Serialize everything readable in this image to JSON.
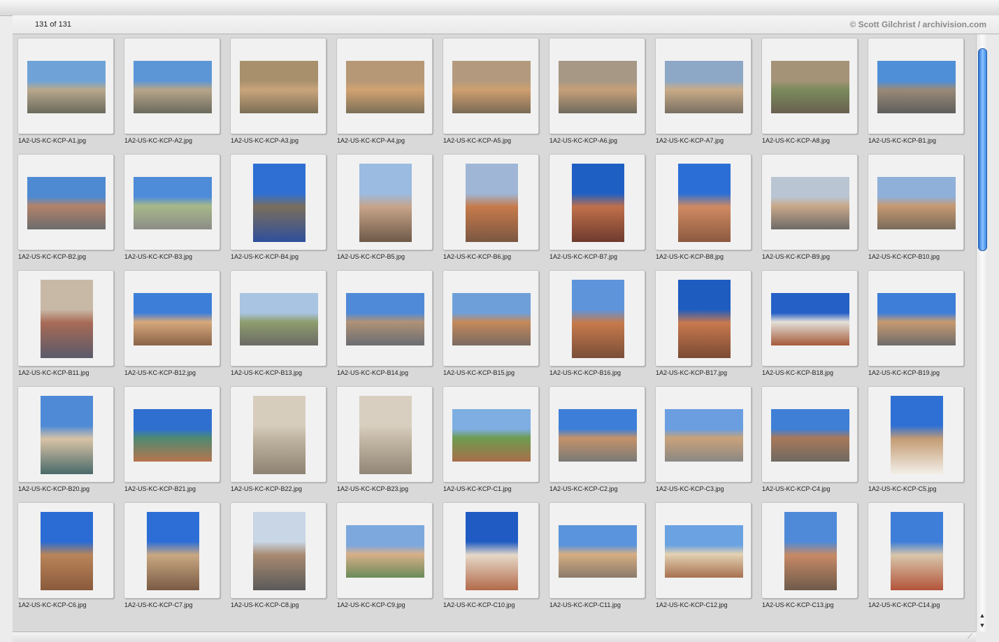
{
  "header": {
    "count": "131 of 131",
    "copyright": "© Scott Gilchrist / archivision.com"
  },
  "thumbnails": [
    {
      "name": "1A2-US-KC-KCP-A1.jpg",
      "orient": "landscape",
      "colors": [
        "#6fa3d8",
        "#b9a88d",
        "#6a6a5c"
      ]
    },
    {
      "name": "1A2-US-KC-KCP-A2.jpg",
      "orient": "landscape",
      "colors": [
        "#5c96d6",
        "#b8a58a",
        "#6b6a5e"
      ]
    },
    {
      "name": "1A2-US-KC-KCP-A3.jpg",
      "orient": "landscape",
      "colors": [
        "#a8906c",
        "#c9a47c",
        "#7b6f55"
      ]
    },
    {
      "name": "1A2-US-KC-KCP-A4.jpg",
      "orient": "landscape",
      "colors": [
        "#b69876",
        "#d2a272",
        "#7c7058"
      ]
    },
    {
      "name": "1A2-US-KC-KCP-A5.jpg",
      "orient": "landscape",
      "colors": [
        "#b39a7e",
        "#cf9f70",
        "#7a6b55"
      ]
    },
    {
      "name": "1A2-US-KC-KCP-A6.jpg",
      "orient": "landscape",
      "colors": [
        "#a69885",
        "#c7a07a",
        "#6f6a5d"
      ]
    },
    {
      "name": "1A2-US-KC-KCP-A7.jpg",
      "orient": "landscape",
      "colors": [
        "#8da8c6",
        "#c9ab86",
        "#797064"
      ]
    },
    {
      "name": "1A2-US-KC-KCP-A8.jpg",
      "orient": "landscape",
      "colors": [
        "#a59378",
        "#7a8a5c",
        "#6a6050"
      ]
    },
    {
      "name": "1A2-US-KC-KCP-B1.jpg",
      "orient": "landscape",
      "colors": [
        "#4f8fd8",
        "#9a8a78",
        "#5e5e5c"
      ]
    },
    {
      "name": "1A2-US-KC-KCP-B2.jpg",
      "orient": "landscape",
      "colors": [
        "#4d8ad2",
        "#b2836a",
        "#6c6c6c"
      ]
    },
    {
      "name": "1A2-US-KC-KCP-B3.jpg",
      "orient": "landscape",
      "colors": [
        "#4e8bd8",
        "#a7b98a",
        "#8c8c86"
      ]
    },
    {
      "name": "1A2-US-KC-KCP-B4.jpg",
      "orient": "portrait",
      "colors": [
        "#2f6fd4",
        "#7a6e5c",
        "#2f4f9c"
      ]
    },
    {
      "name": "1A2-US-KC-KCP-B5.jpg",
      "orient": "portrait",
      "colors": [
        "#9bbbe0",
        "#c7a48a",
        "#6e5a48"
      ]
    },
    {
      "name": "1A2-US-KC-KCP-B6.jpg",
      "orient": "portrait",
      "colors": [
        "#9fb6d6",
        "#c67a4a",
        "#7b5742"
      ]
    },
    {
      "name": "1A2-US-KC-KCP-B7.jpg",
      "orient": "portrait",
      "colors": [
        "#1e5fc4",
        "#c0704a",
        "#6e3a2e"
      ]
    },
    {
      "name": "1A2-US-KC-KCP-B8.jpg",
      "orient": "portrait",
      "colors": [
        "#2b6fd6",
        "#d08a62",
        "#8c5a40"
      ]
    },
    {
      "name": "1A2-US-KC-KCP-B9.jpg",
      "orient": "landscape",
      "colors": [
        "#b9c5d2",
        "#c9a88a",
        "#6e6a66"
      ]
    },
    {
      "name": "1A2-US-KC-KCP-B10.jpg",
      "orient": "landscape",
      "colors": [
        "#8fb0d8",
        "#c69a72",
        "#7a6a5a"
      ]
    },
    {
      "name": "1A2-US-KC-KCP-B11.jpg",
      "orient": "portrait",
      "colors": [
        "#c8b9a6",
        "#a86a56",
        "#5a5a6a"
      ]
    },
    {
      "name": "1A2-US-KC-KCP-B12.jpg",
      "orient": "landscape",
      "colors": [
        "#3d7fd8",
        "#d6a87c",
        "#8a6448"
      ]
    },
    {
      "name": "1A2-US-KC-KCP-B13.jpg",
      "orient": "landscape",
      "colors": [
        "#a9c4e2",
        "#8e9e6e",
        "#6c6a66"
      ]
    },
    {
      "name": "1A2-US-KC-KCP-B14.jpg",
      "orient": "landscape",
      "colors": [
        "#4f8ad8",
        "#b09276",
        "#6a6c72"
      ]
    },
    {
      "name": "1A2-US-KC-KCP-B15.jpg",
      "orient": "landscape",
      "colors": [
        "#6f9fd8",
        "#c58a5a",
        "#7a6a62"
      ]
    },
    {
      "name": "1A2-US-KC-KCP-B16.jpg",
      "orient": "portrait",
      "colors": [
        "#5e95da",
        "#c77a4c",
        "#7a4e38"
      ]
    },
    {
      "name": "1A2-US-KC-KCP-B17.jpg",
      "orient": "portrait",
      "colors": [
        "#1f5cc0",
        "#c8794e",
        "#7a4a34"
      ]
    },
    {
      "name": "1A2-US-KC-KCP-B18.jpg",
      "orient": "landscape",
      "colors": [
        "#2560c6",
        "#e3e0d8",
        "#a55a3a"
      ]
    },
    {
      "name": "1A2-US-KC-KCP-B19.jpg",
      "orient": "landscape",
      "colors": [
        "#3e7ed8",
        "#c79a70",
        "#6e6c6a"
      ]
    },
    {
      "name": "1A2-US-KC-KCP-B20.jpg",
      "orient": "portrait",
      "colors": [
        "#4e8ad6",
        "#d8c3a6",
        "#4a6a6a"
      ]
    },
    {
      "name": "1A2-US-KC-KCP-B21.jpg",
      "orient": "landscape",
      "colors": [
        "#2f6fd0",
        "#4e8a72",
        "#b8744e"
      ]
    },
    {
      "name": "1A2-US-KC-KCP-B22.jpg",
      "orient": "portrait",
      "colors": [
        "#d7cdbd",
        "#bfb3a0",
        "#8e8272"
      ]
    },
    {
      "name": "1A2-US-KC-KCP-B23.jpg",
      "orient": "portrait",
      "colors": [
        "#d9cfc0",
        "#c4b8a6",
        "#928676"
      ]
    },
    {
      "name": "1A2-US-KC-KCP-C1.jpg",
      "orient": "landscape",
      "colors": [
        "#7eaee2",
        "#6e9c50",
        "#a86e4a"
      ]
    },
    {
      "name": "1A2-US-KC-KCP-C2.jpg",
      "orient": "landscape",
      "colors": [
        "#3d7fd8",
        "#c4926a",
        "#7a7a76"
      ]
    },
    {
      "name": "1A2-US-KC-KCP-C3.jpg",
      "orient": "landscape",
      "colors": [
        "#6a9ee0",
        "#caa27a",
        "#8a8884"
      ]
    },
    {
      "name": "1A2-US-KC-KCP-C4.jpg",
      "orient": "landscape",
      "colors": [
        "#3f7fd6",
        "#a8785a",
        "#6e6a60"
      ]
    },
    {
      "name": "1A2-US-KC-KCP-C5.jpg",
      "orient": "portrait",
      "colors": [
        "#2e70d4",
        "#c49c74",
        "#f2efe8"
      ]
    },
    {
      "name": "1A2-US-KC-KCP-C6.jpg",
      "orient": "portrait",
      "colors": [
        "#2a6cd4",
        "#b98458",
        "#8a5a3c"
      ]
    },
    {
      "name": "1A2-US-KC-KCP-C7.jpg",
      "orient": "portrait",
      "colors": [
        "#2c6ed6",
        "#c9a882",
        "#7a5a44"
      ]
    },
    {
      "name": "1A2-US-KC-KCP-C8.jpg",
      "orient": "portrait",
      "colors": [
        "#c8d6e6",
        "#a88a70",
        "#5a5a5a"
      ]
    },
    {
      "name": "1A2-US-KC-KCP-C9.jpg",
      "orient": "landscape",
      "colors": [
        "#7ca8de",
        "#d8b08a",
        "#6a8a58"
      ]
    },
    {
      "name": "1A2-US-KC-KCP-C10.jpg",
      "orient": "portrait",
      "colors": [
        "#1f5bc2",
        "#e6d8c8",
        "#b36a4a"
      ]
    },
    {
      "name": "1A2-US-KC-KCP-C11.jpg",
      "orient": "landscape",
      "colors": [
        "#5a94dc",
        "#d6ae84",
        "#8a7a6a"
      ]
    },
    {
      "name": "1A2-US-KC-KCP-C12.jpg",
      "orient": "landscape",
      "colors": [
        "#6aa2e2",
        "#e2d2b2",
        "#a87050"
      ]
    },
    {
      "name": "1A2-US-KC-KCP-C13.jpg",
      "orient": "portrait",
      "colors": [
        "#4f8ad8",
        "#c78a66",
        "#6e5a4a"
      ]
    },
    {
      "name": "1A2-US-KC-KCP-C14.jpg",
      "orient": "portrait",
      "colors": [
        "#3e7ed8",
        "#d8c6aa",
        "#b3543a"
      ]
    }
  ]
}
